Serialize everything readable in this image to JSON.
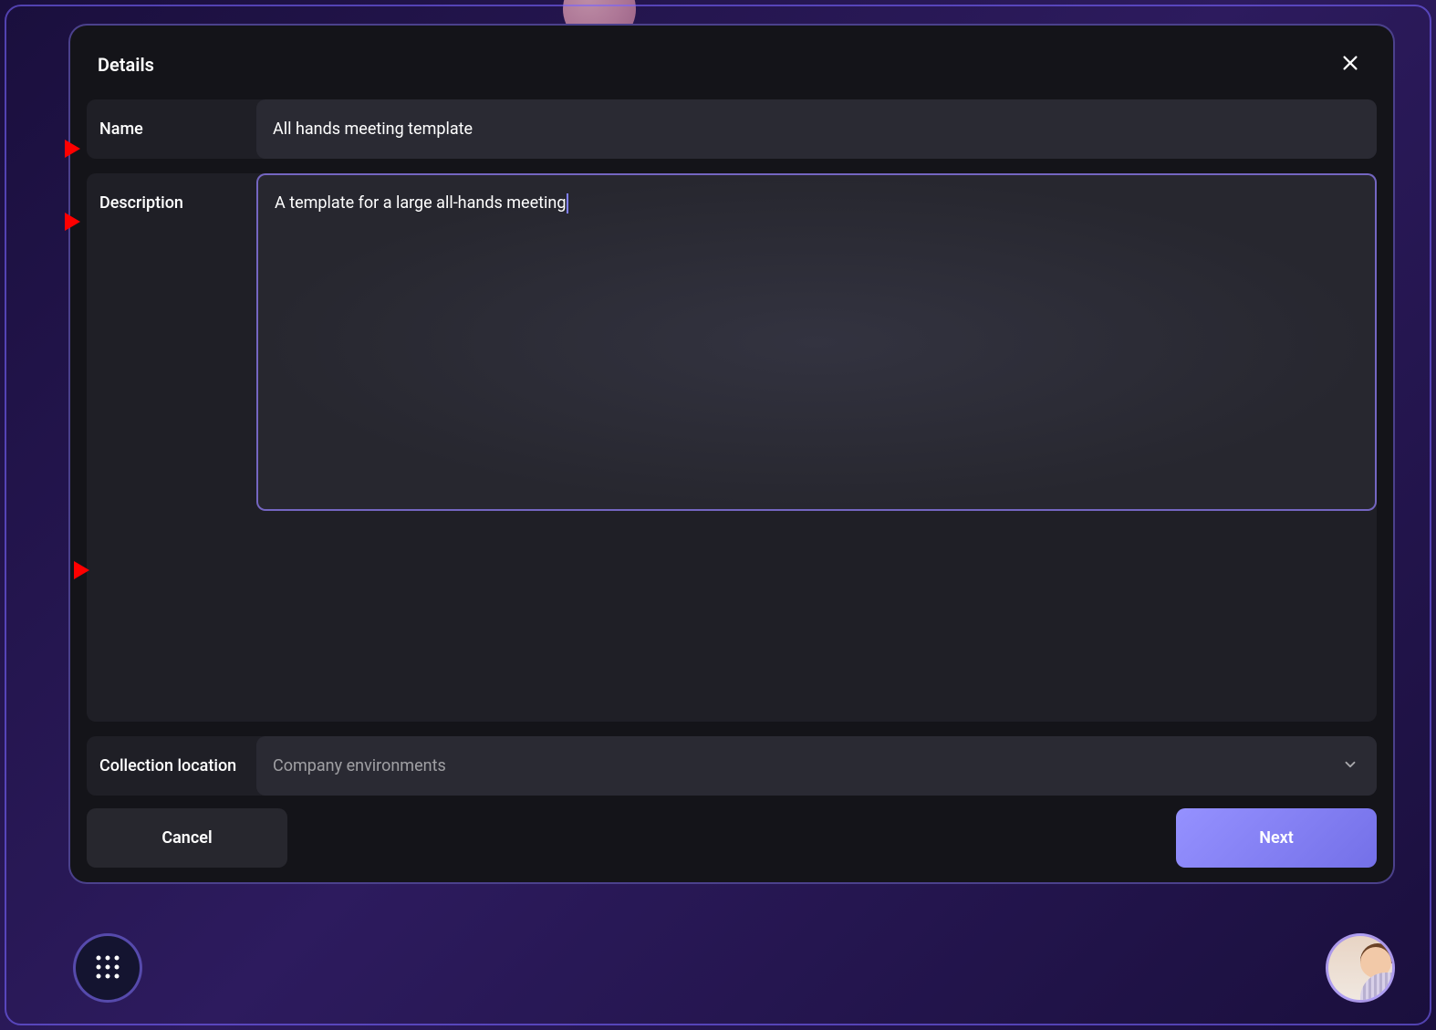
{
  "modal": {
    "title": "Details",
    "fields": {
      "name": {
        "label": "Name",
        "value": "All hands meeting template"
      },
      "description": {
        "label": "Description",
        "value": "A template for a large all-hands meeting"
      },
      "collection": {
        "label": "Collection location",
        "value": "Company environments"
      }
    },
    "buttons": {
      "cancel": "Cancel",
      "next": "Next"
    }
  }
}
